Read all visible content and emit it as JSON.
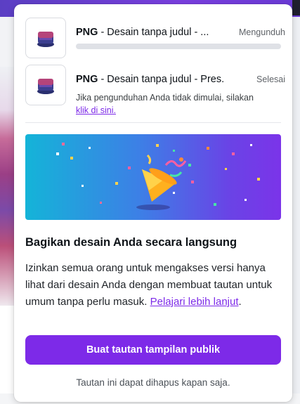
{
  "downloads": [
    {
      "format": "PNG",
      "name": " - Desain tanpa judul - ...",
      "status": "Mengunduh",
      "progress": 0.0
    },
    {
      "format": "PNG",
      "name": " - Desain tanpa judul - Pres...",
      "status": "Selesai",
      "note": "Jika pengunduhan Anda tidak dimulai, silakan",
      "note_link": "klik di sini."
    }
  ],
  "share": {
    "heading": "Bagikan desain Anda secara langsung",
    "body": "Izinkan semua orang untuk mengakses versi hanya lihat dari desain Anda dengan membuat tautan untuk umum tanpa perlu masuk. ",
    "link": "Pelajari lebih lanjut",
    "body_end": ".",
    "button": "Buat tautan tampilan publik",
    "footer": "Tautan ini dapat dihapus kapan saja."
  },
  "colors": {
    "accent": "#7d2ae8",
    "hero_gradient": [
      "#14b4d8",
      "#7b34e9"
    ]
  },
  "icons": {
    "thumbnail": "design-thumbnail-icon",
    "hero": "party-popper-icon"
  }
}
